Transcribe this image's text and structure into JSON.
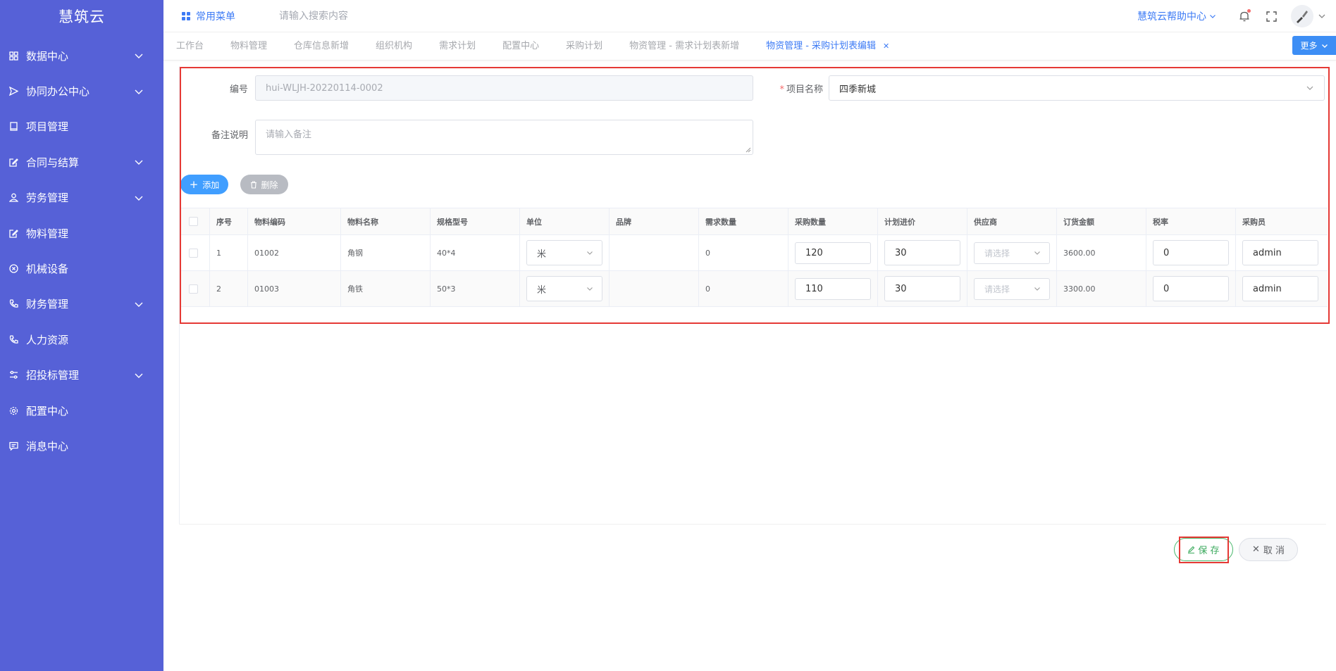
{
  "app": {
    "title": "慧筑云"
  },
  "sidebar": {
    "items": [
      {
        "label": "数据中心",
        "icon": "grid-icon",
        "expandable": true
      },
      {
        "label": "协同办公中心",
        "icon": "send-icon",
        "expandable": true
      },
      {
        "label": "项目管理",
        "icon": "book-icon",
        "expandable": false
      },
      {
        "label": "合同与结算",
        "icon": "edit-icon",
        "expandable": true
      },
      {
        "label": "劳务管理",
        "icon": "user-icon",
        "expandable": true
      },
      {
        "label": "物料管理",
        "icon": "edit-icon",
        "expandable": false
      },
      {
        "label": "机械设备",
        "icon": "circle-x-icon",
        "expandable": false
      },
      {
        "label": "财务管理",
        "icon": "phone-icon",
        "expandable": true
      },
      {
        "label": "人力资源",
        "icon": "phone-icon",
        "expandable": false
      },
      {
        "label": "招投标管理",
        "icon": "sliders-icon",
        "expandable": true
      },
      {
        "label": "配置中心",
        "icon": "gear-icon",
        "expandable": false
      },
      {
        "label": "消息中心",
        "icon": "message-icon",
        "expandable": false
      }
    ]
  },
  "header": {
    "common_menu": "常用菜单",
    "search_placeholder": "请输入搜索内容",
    "help": "慧筑云帮助中心"
  },
  "tabs": {
    "items": [
      {
        "label": "工作台"
      },
      {
        "label": "物料管理"
      },
      {
        "label": "仓库信息新增"
      },
      {
        "label": "组织机构"
      },
      {
        "label": "需求计划"
      },
      {
        "label": "配置中心"
      },
      {
        "label": "采购计划"
      },
      {
        "label": "物资管理 - 需求计划表新增"
      },
      {
        "label": "物资管理 - 采购计划表编辑",
        "active": true
      }
    ],
    "more": "更多"
  },
  "form": {
    "code_label": "编号",
    "code_value": "hui-WLJH-20220114-0002",
    "project_label": "项目名称",
    "project_value": "四季新城",
    "remark_label": "备注说明",
    "remark_placeholder": "请输入备注"
  },
  "actions": {
    "add": "添加",
    "delete": "删除",
    "save": "保 存",
    "cancel": "取 消"
  },
  "table": {
    "columns": [
      "序号",
      "物料编码",
      "物料名称",
      "规格型号",
      "单位",
      "品牌",
      "需求数量",
      "采购数量",
      "计划进价",
      "供应商",
      "订货金额",
      "税率",
      "采购员"
    ],
    "supplier_placeholder": "请选择",
    "rows": [
      {
        "index": "1",
        "code": "01002",
        "name": "角钢",
        "spec": "40*4",
        "unit": "米",
        "brand": "",
        "demand": "0",
        "purchase": "120",
        "price": "30",
        "amount": "3600.00",
        "tax": "0",
        "buyer": "admin"
      },
      {
        "index": "2",
        "code": "01003",
        "name": "角铁",
        "spec": "50*3",
        "unit": "米",
        "brand": "",
        "demand": "0",
        "purchase": "110",
        "price": "30",
        "amount": "3300.00",
        "tax": "0",
        "buyer": "admin"
      }
    ]
  },
  "colors": {
    "sidebar_bg": "#5661d7",
    "primary": "#3d7bf5",
    "highlight_box": "#e53935",
    "save_green": "#3aa95c"
  }
}
